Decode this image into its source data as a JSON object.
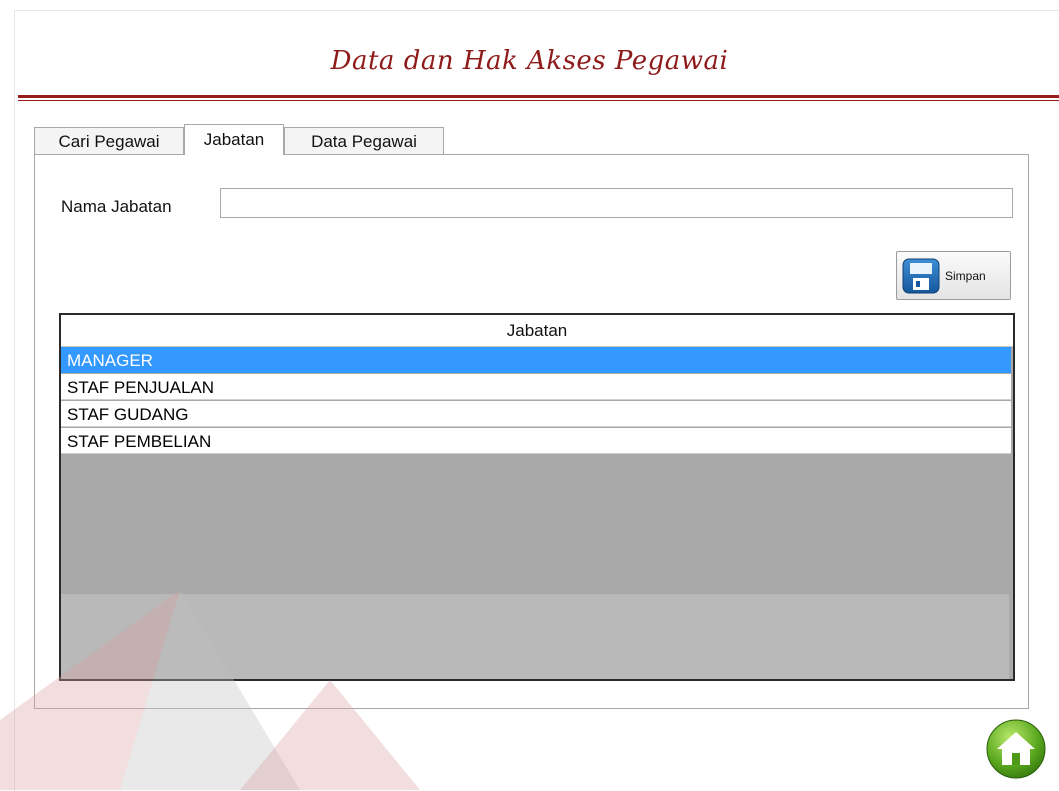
{
  "page": {
    "title": "Data dan Hak Akses Pegawai"
  },
  "tabs": [
    {
      "label": "Cari Pegawai"
    },
    {
      "label": "Jabatan"
    },
    {
      "label": "Data Pegawai"
    }
  ],
  "form": {
    "nama_jabatan_label": "Nama Jabatan",
    "nama_jabatan_value": ""
  },
  "save_button": {
    "label": "Simpan",
    "icon": "floppy-disk-icon"
  },
  "table": {
    "header": "Jabatan",
    "rows": [
      "MANAGER",
      "STAF PENJUALAN",
      "STAF GUDANG",
      "STAF PEMBELIAN"
    ],
    "selected_row": 0
  },
  "home_button": {
    "icon": "home-icon"
  },
  "colors": {
    "title": "#8e1a1a",
    "selection": "#3399ff",
    "empty_grid": "#a9a9a9"
  }
}
